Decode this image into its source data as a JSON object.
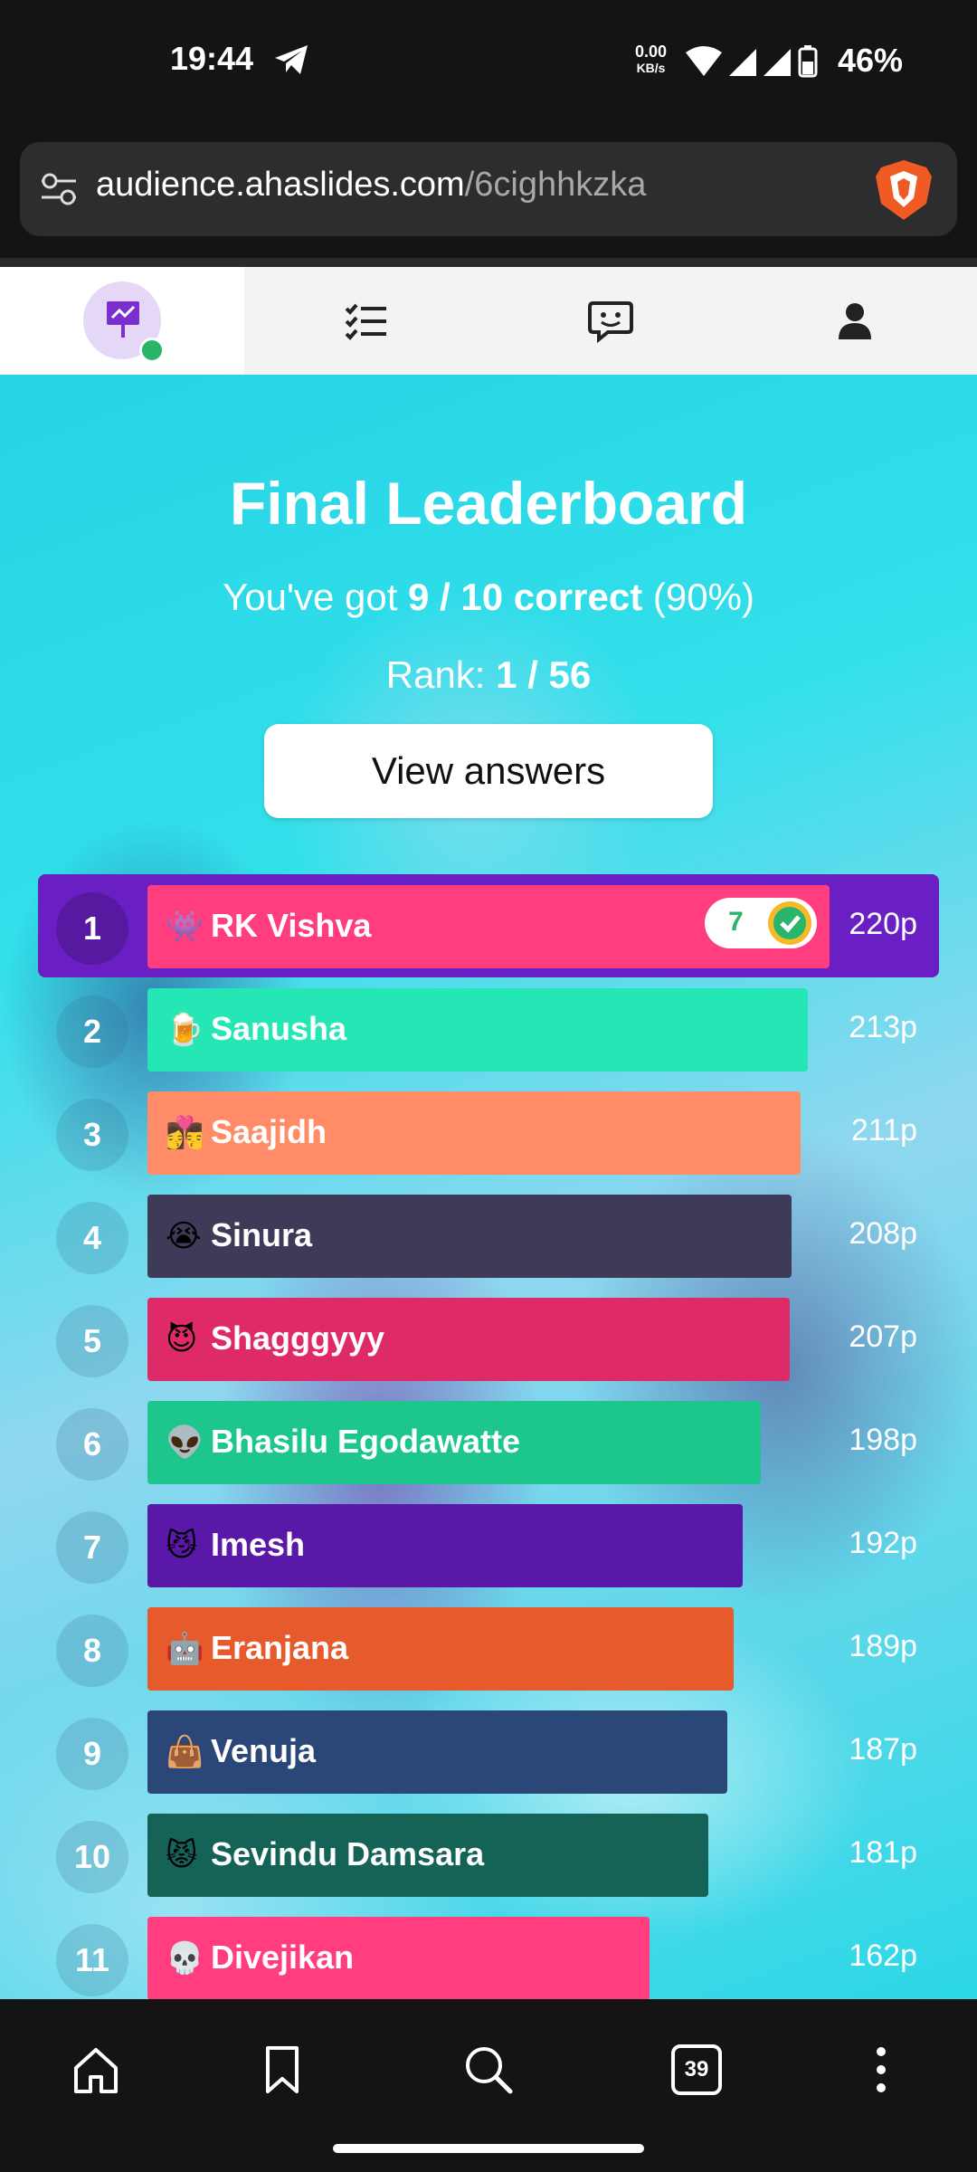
{
  "status_bar": {
    "time": "19:44",
    "net_speed_value": "0.00",
    "net_speed_unit": "KB/s",
    "battery": "46%"
  },
  "browser": {
    "url_domain": "audience.ahaslides.com",
    "url_path": "/6cighhkzka"
  },
  "tabs": [
    {
      "name": "presentation-icon",
      "active": true
    },
    {
      "name": "checklist-icon",
      "active": false
    },
    {
      "name": "chat-icon",
      "active": false
    },
    {
      "name": "profile-icon",
      "active": false
    }
  ],
  "header": {
    "title": "Final Leaderboard",
    "score_prefix": "You've got",
    "score_value": "9 / 10 correct",
    "score_percent": "(90%)",
    "rank_label": "Rank:",
    "rank_value": "1 / 56",
    "view_answers_label": "View answers"
  },
  "leaderboard": [
    {
      "rank": "1",
      "emoji": "👾",
      "name": "RK Vishva",
      "points": "220p",
      "color": "#ff3d7f",
      "streak": "7",
      "me": true
    },
    {
      "rank": "2",
      "emoji": "🍺",
      "name": "Sanusha",
      "points": "213p",
      "color": "#25e7b5"
    },
    {
      "rank": "3",
      "emoji": "👩‍❤️‍💋‍👨",
      "name": "Saajidh",
      "points": "211p",
      "color": "#ff8c66"
    },
    {
      "rank": "4",
      "emoji": "😭",
      "name": "Sinura",
      "points": "208p",
      "color": "#3d3b58"
    },
    {
      "rank": "5",
      "emoji": "😈",
      "name": "Shagggyyy",
      "points": "207p",
      "color": "#df2a69"
    },
    {
      "rank": "6",
      "emoji": "👽",
      "name": "Bhasilu Egodawatte",
      "points": "198p",
      "color": "#1cc68d"
    },
    {
      "rank": "7",
      "emoji": "😼",
      "name": "Imesh",
      "points": "192p",
      "color": "#5a18a8"
    },
    {
      "rank": "8",
      "emoji": "🤖",
      "name": "Eranjana",
      "points": "189p",
      "color": "#e65a2c"
    },
    {
      "rank": "9",
      "emoji": "👜",
      "name": "Venuja",
      "points": "187p",
      "color": "#2a4778"
    },
    {
      "rank": "10",
      "emoji": "😾",
      "name": "Sevindu Damsara",
      "points": "181p",
      "color": "#146356"
    },
    {
      "rank": "11",
      "emoji": "💀",
      "name": "Divejikan",
      "points": "162p",
      "color": "#ff3d7f"
    }
  ],
  "bottom_nav": {
    "tab_count": "39",
    "items": [
      "home-icon",
      "bookmark-icon",
      "search-icon",
      "tabs-icon",
      "more-icon"
    ]
  }
}
